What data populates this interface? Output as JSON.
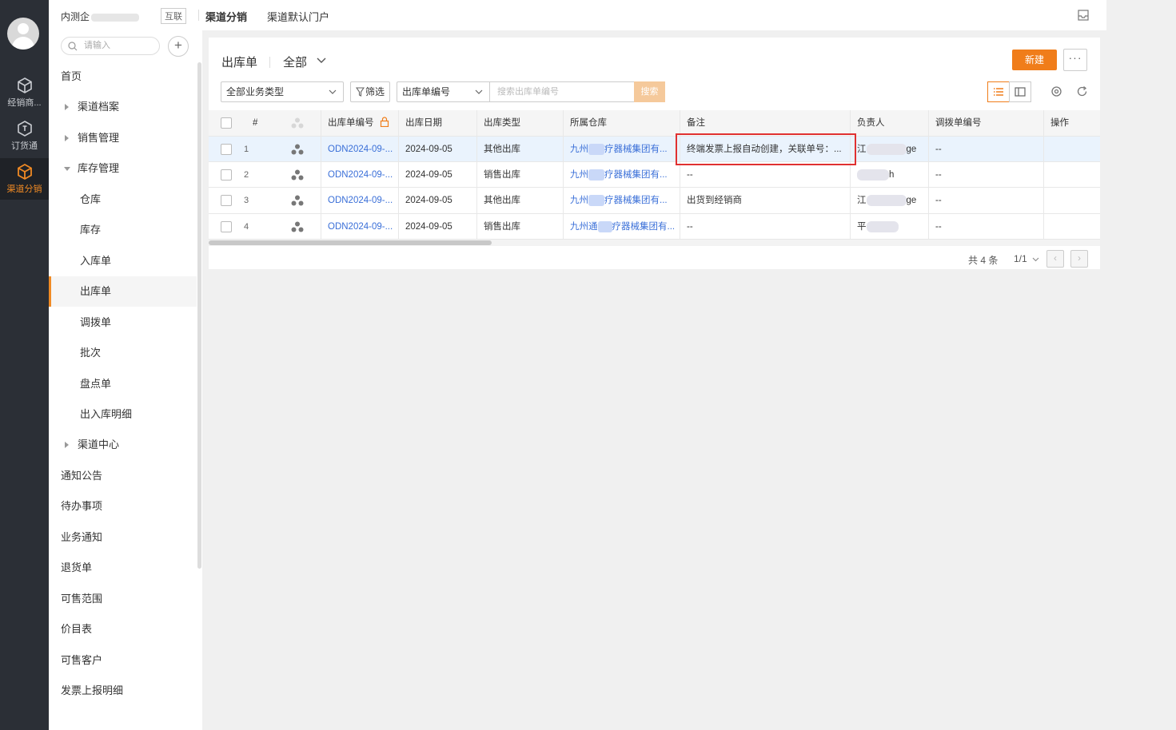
{
  "rail": {
    "items": [
      {
        "label": "经销商...",
        "icon": "cube-icon"
      },
      {
        "label": "订货通",
        "icon": "order-icon"
      },
      {
        "label": "渠道分销",
        "icon": "cube-icon"
      }
    ]
  },
  "sidebar": {
    "org": "内测企",
    "tag": "互联",
    "search_placeholder": "请输入",
    "items": [
      {
        "label": "首页"
      },
      {
        "label": "渠道档案"
      },
      {
        "label": "销售管理"
      },
      {
        "label": "库存管理"
      },
      {
        "label": "仓库"
      },
      {
        "label": "库存"
      },
      {
        "label": "入库单"
      },
      {
        "label": "出库单"
      },
      {
        "label": "调拨单"
      },
      {
        "label": "批次"
      },
      {
        "label": "盘点单"
      },
      {
        "label": "出入库明细"
      },
      {
        "label": "渠道中心"
      },
      {
        "label": "通知公告"
      },
      {
        "label": "待办事项"
      },
      {
        "label": "业务通知"
      },
      {
        "label": "退货单"
      },
      {
        "label": "可售范围"
      },
      {
        "label": "价目表"
      },
      {
        "label": "可售客户"
      },
      {
        "label": "发票上报明细"
      }
    ]
  },
  "topbar": {
    "tabs": [
      "渠道分销",
      "渠道默认门户"
    ]
  },
  "page": {
    "title": "出库单",
    "view": "全部",
    "new_label": "新建",
    "more_label": "···",
    "biz_type": "全部业务类型",
    "filter_label": "筛选",
    "search_field": "出库单编号",
    "search_placeholder": "搜索出库单编号",
    "search_label": "搜索"
  },
  "table": {
    "columns": [
      "#",
      "出库单编号",
      "出库日期",
      "出库类型",
      "所属仓库",
      "备注",
      "负责人",
      "调拨单编号",
      "操作"
    ],
    "rows": [
      {
        "idx": "1",
        "no": "ODN2024-09-...",
        "date": "2024-09-05",
        "type": "其他出库",
        "wh_a": "九州",
        "wh_b": "疗器械集团有...",
        "note": "终端发票上报自动创建，关联单号：...",
        "owner_a": "江",
        "owner_b": "ge",
        "transfer": "--"
      },
      {
        "idx": "2",
        "no": "ODN2024-09-...",
        "date": "2024-09-05",
        "type": "销售出库",
        "wh_a": "九州",
        "wh_b": "疗器械集团有...",
        "note": "--",
        "owner_a": "",
        "owner_b": "h",
        "transfer": "--"
      },
      {
        "idx": "3",
        "no": "ODN2024-09-...",
        "date": "2024-09-05",
        "type": "其他出库",
        "wh_a": "九州",
        "wh_b": "疗器械集团有...",
        "note": "出货到经销商",
        "owner_a": "江",
        "owner_b": "ge",
        "transfer": "--"
      },
      {
        "idx": "4",
        "no": "ODN2024-09-...",
        "date": "2024-09-05",
        "type": "销售出库",
        "wh_a": "九州通",
        "wh_b": "疗器械集团有...",
        "note": "--",
        "owner_a": "平",
        "owner_b": "",
        "transfer": "--"
      }
    ]
  },
  "pagination": {
    "total": "共 4 条",
    "page": "1/1"
  },
  "colors": {
    "accent": "#f07d1a",
    "link": "#3a6fd8",
    "highlight": "#e03131",
    "rail_bg": "#2b2f36"
  }
}
